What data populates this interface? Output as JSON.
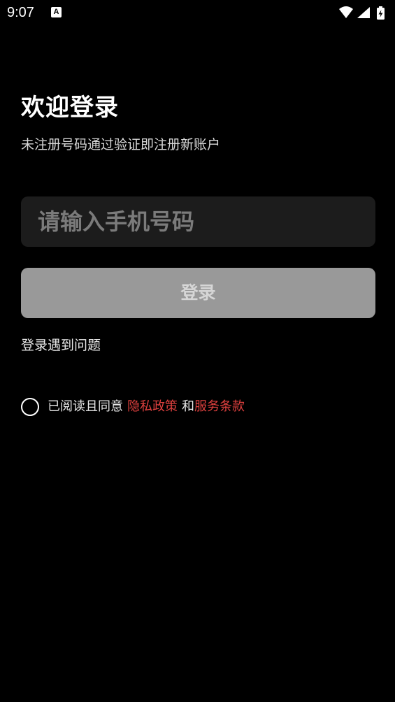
{
  "status_bar": {
    "time": "9:07",
    "notification_icon_label": "A"
  },
  "login": {
    "title": "欢迎登录",
    "subtitle": "未注册号码通过验证即注册新账户",
    "phone_placeholder": "请输入手机号码",
    "phone_value": "",
    "login_button_label": "登录",
    "help_link": "登录遇到问题"
  },
  "agreement": {
    "prefix": "已阅读且同意",
    "privacy_policy": "隐私政策",
    "and": "和",
    "terms_of_service": "服务条款",
    "checked": false
  },
  "colors": {
    "background": "#000000",
    "link_red": "#e0413f",
    "button_disabled": "#999999",
    "input_bg": "#1c1c1c"
  }
}
